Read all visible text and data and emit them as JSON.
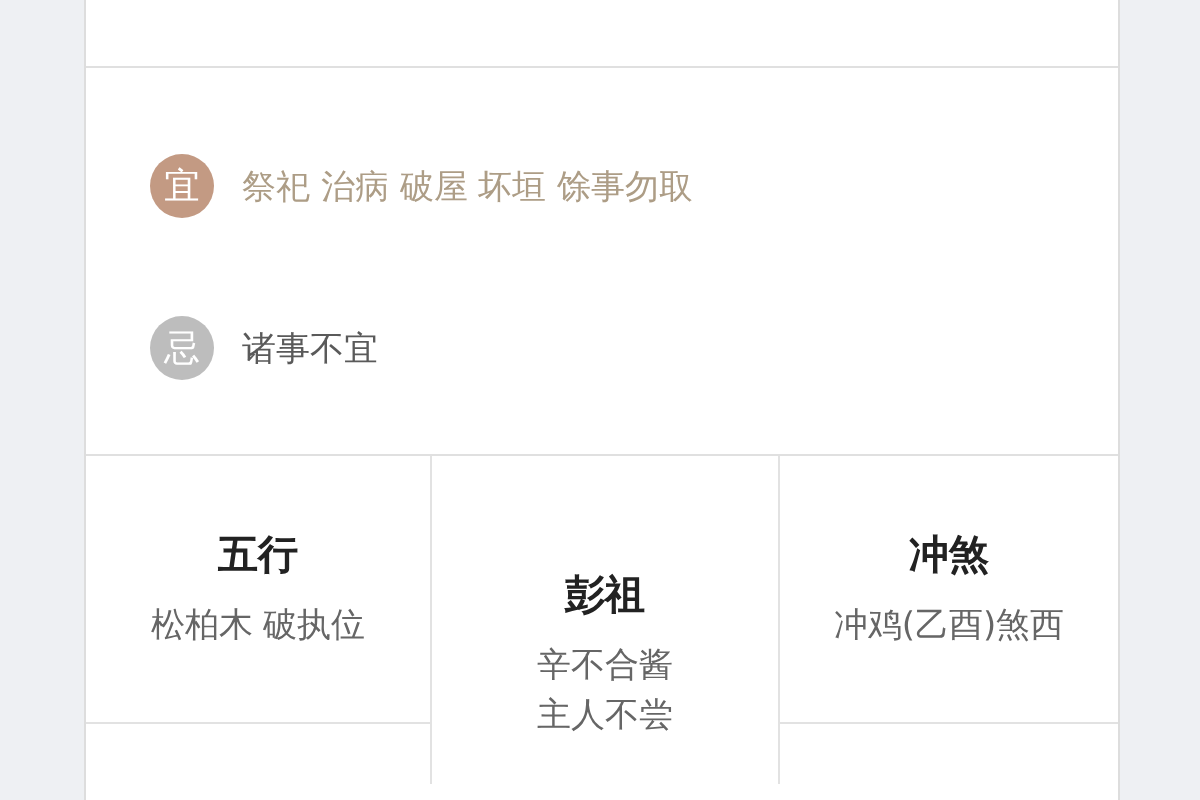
{
  "rules": [
    {
      "kind": "good",
      "badge": "宜",
      "color": "#c39a83",
      "text": "祭祀 治病 破屋 坏垣 馀事勿取"
    },
    {
      "kind": "bad",
      "badge": "忌",
      "color": "#bdbdbd",
      "text": "诸事不宜"
    }
  ],
  "cells": [
    {
      "title": "五行",
      "lines": [
        "松柏木 破执位"
      ]
    },
    {
      "title": "彭祖",
      "lines": [
        "辛不合酱",
        "主人不尝"
      ]
    },
    {
      "title": "冲煞",
      "lines": [
        "冲鸡(乙酉)煞西"
      ]
    }
  ]
}
